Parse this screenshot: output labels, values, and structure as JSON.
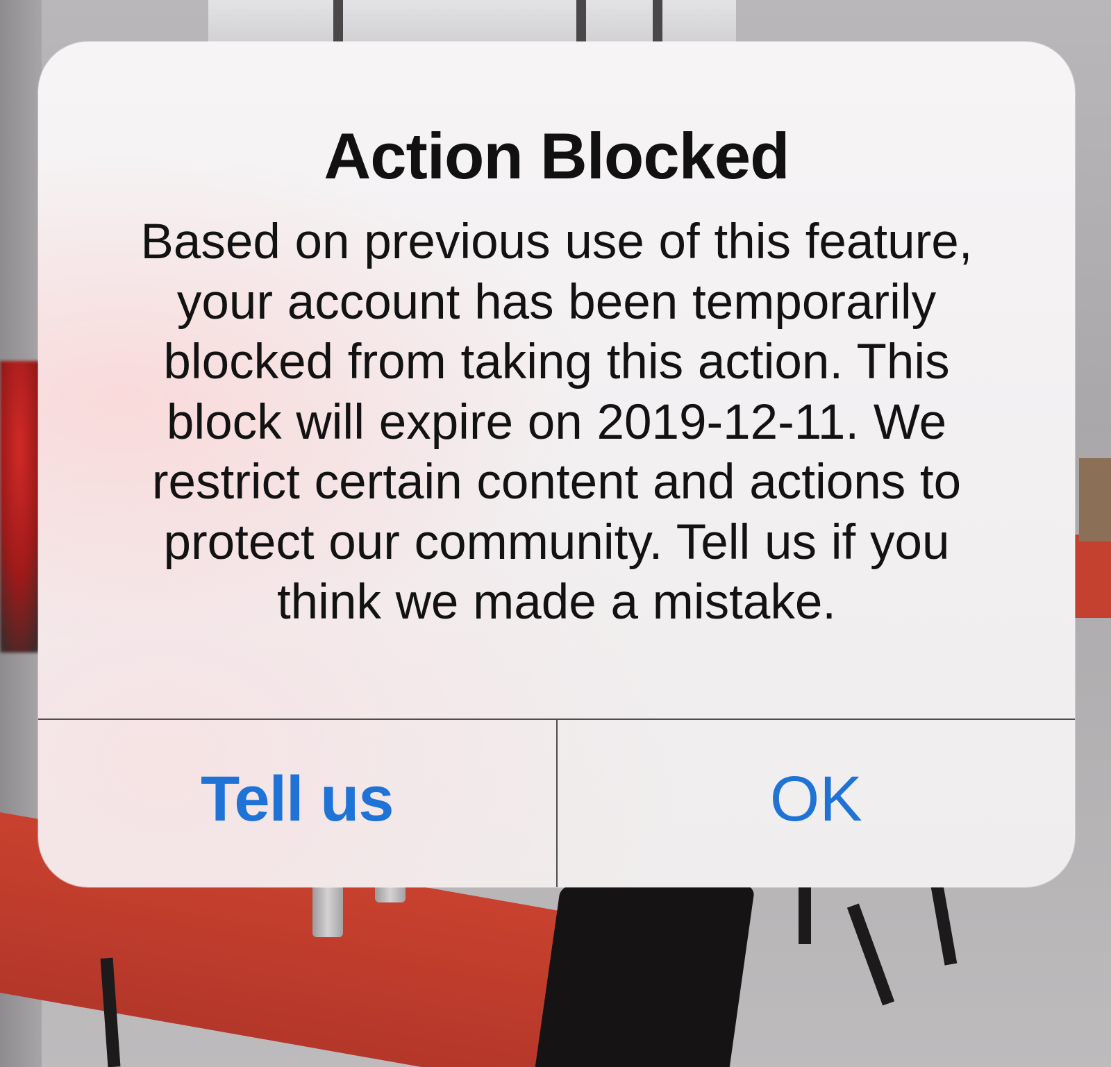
{
  "alert": {
    "title": "Action Blocked",
    "message_lines": [
      "Based on previous use of this feature,",
      "your account has been temporarily",
      "blocked from taking this action. This",
      "block will expire on 2019-12-11. We",
      "restrict certain content and actions to",
      "protect our community. Tell us if you",
      "think we made a mistake."
    ],
    "buttons": {
      "tell_us_label": "Tell us",
      "ok_label": "OK"
    }
  },
  "colors": {
    "button_text": "#1f72d6",
    "title_text": "#111111",
    "divider": "#4f4d4e"
  }
}
